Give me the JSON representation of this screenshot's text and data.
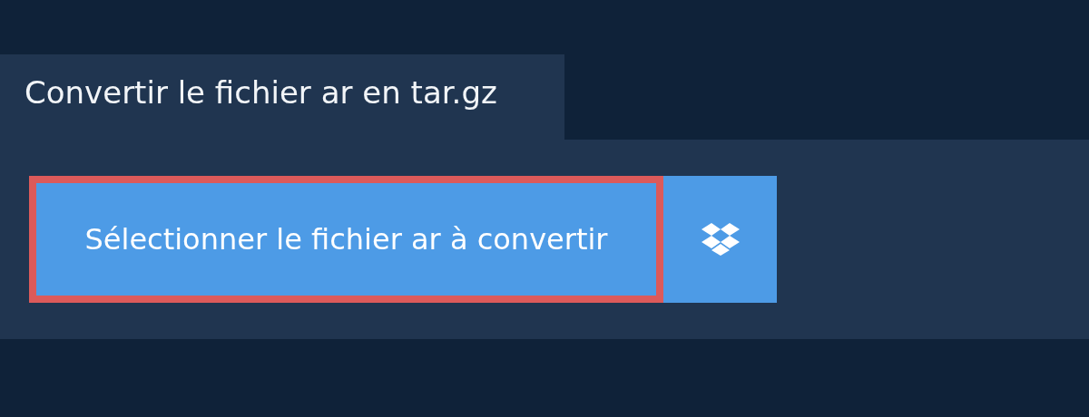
{
  "tab": {
    "title": "Convertir le fichier ar en tar.gz"
  },
  "upload": {
    "label": "Sélectionner le fichier ar à convertir",
    "focused": true
  }
}
